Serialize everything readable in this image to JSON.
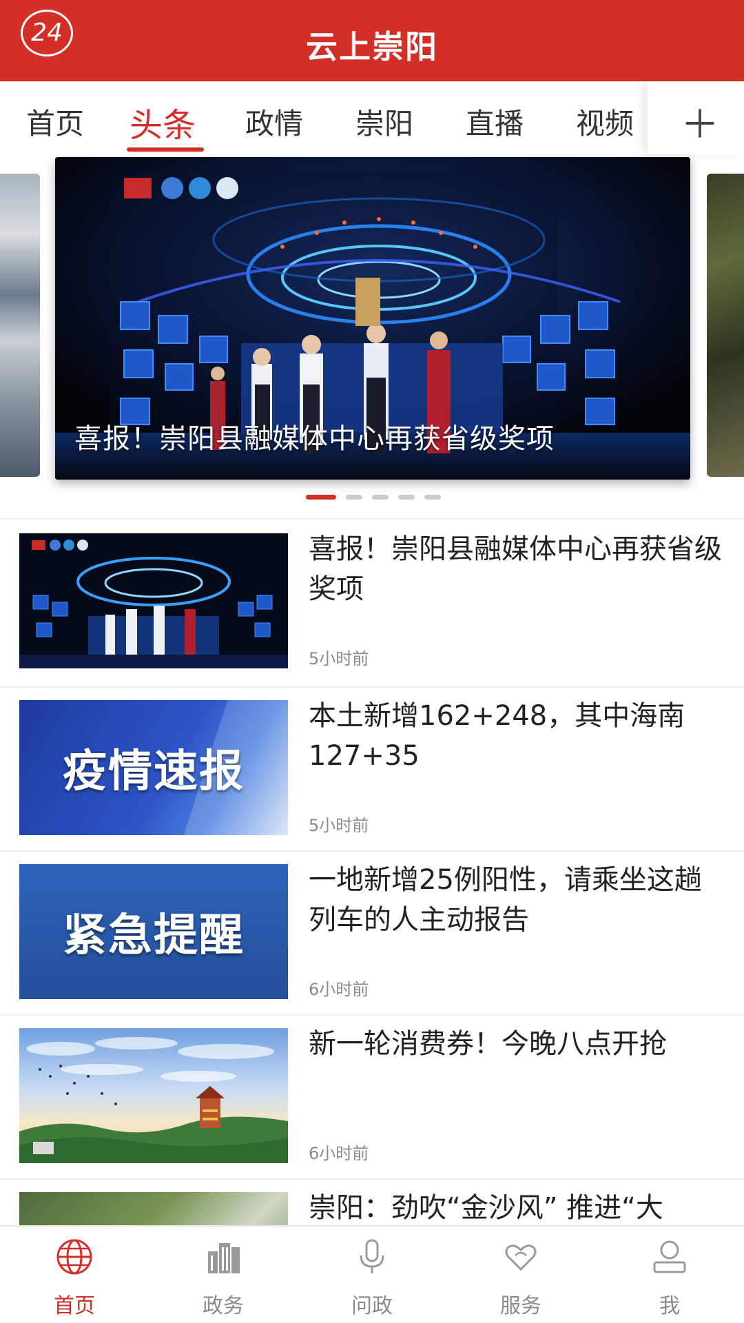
{
  "header": {
    "badge": "24",
    "title": "云上崇阳"
  },
  "tabs": [
    {
      "label": "首页"
    },
    {
      "label": "头条",
      "active": true
    },
    {
      "label": "政情"
    },
    {
      "label": "崇阳"
    },
    {
      "label": "直播"
    },
    {
      "label": "视频"
    }
  ],
  "tab_more_icon": "plus-icon",
  "carousel": {
    "caption": "喜报！崇阳县融媒体中心再获省级奖项",
    "slide_count": 5,
    "active_index": 0
  },
  "news": [
    {
      "title": "喜报！崇阳县融媒体中心再获省级奖项",
      "time": "5小时前",
      "thumb_text": ""
    },
    {
      "title": "本土新增162+248，其中海南127+35",
      "time": "5小时前",
      "thumb_text": "疫情速报"
    },
    {
      "title": "一地新增25例阳性，请乘坐这趟列车的人主动报告",
      "time": "6小时前",
      "thumb_text": "紧急提醒"
    },
    {
      "title": "新一轮消费券！今晚八点开抢",
      "time": "6小时前",
      "thumb_text": ""
    },
    {
      "title": "崇阳：劲吹“金沙风” 推进“大",
      "time": "",
      "thumb_text": ""
    }
  ],
  "bottom_nav": [
    {
      "label": "首页",
      "icon": "globe-icon",
      "active": true
    },
    {
      "label": "政务",
      "icon": "buildings-icon"
    },
    {
      "label": "问政",
      "icon": "microphone-icon"
    },
    {
      "label": "服务",
      "icon": "hearts-icon"
    },
    {
      "label": "我",
      "icon": "user-icon"
    }
  ],
  "colors": {
    "brand": "#d42f26",
    "muted": "#8a8a8a"
  }
}
